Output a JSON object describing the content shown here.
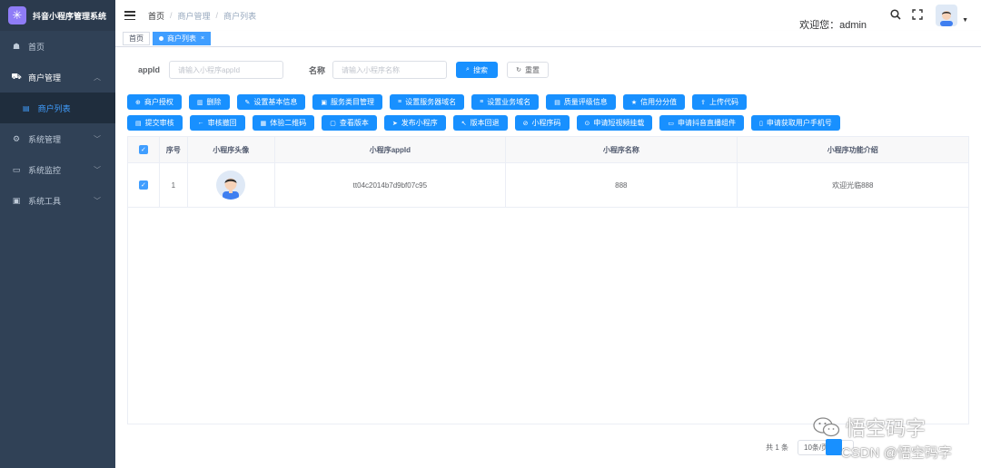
{
  "app": {
    "title": "抖音小程序管理系统",
    "logo_glyph": "✳"
  },
  "sidebar": {
    "items": [
      {
        "label": "首页",
        "icon": "dashboard-icon"
      },
      {
        "label": "商户管理",
        "icon": "shop-icon",
        "open": true
      },
      {
        "label": "商户列表",
        "icon": "list-icon",
        "sub": true,
        "active": true
      },
      {
        "label": "系统管理",
        "icon": "gear-icon"
      },
      {
        "label": "系统监控",
        "icon": "monitor-icon"
      },
      {
        "label": "系统工具",
        "icon": "tool-icon"
      }
    ]
  },
  "header": {
    "breadcrumb": [
      "首页",
      "商户管理",
      "商户列表"
    ],
    "welcome": "欢迎您：admin"
  },
  "tags": [
    {
      "label": "首页",
      "active": false
    },
    {
      "label": "商户列表",
      "active": true,
      "close": "×"
    }
  ],
  "search": {
    "appid_label": "appId",
    "appid_placeholder": "请输入小程序appId",
    "name_label": "名称",
    "name_placeholder": "请输入小程序名称",
    "search_btn": "搜索",
    "reset_btn": "重置"
  },
  "toolbar_row1": [
    {
      "label": "商户授权",
      "icon": "⊕"
    },
    {
      "label": "删除",
      "icon": "🗑"
    },
    {
      "label": "设置基本信息",
      "icon": "✎"
    },
    {
      "label": "服务类目管理",
      "icon": "▣"
    },
    {
      "label": "设置服务器域名",
      "icon": "≡"
    },
    {
      "label": "设置业务域名",
      "icon": "≡"
    },
    {
      "label": "质量评级信息",
      "icon": "▤"
    },
    {
      "label": "信用分分值",
      "icon": "★"
    },
    {
      "label": "上传代码",
      "icon": "⇪"
    }
  ],
  "toolbar_row2": [
    {
      "label": "提交审核",
      "icon": "▤"
    },
    {
      "label": "审核撤回",
      "icon": "←"
    },
    {
      "label": "体验二维码",
      "icon": "▦"
    },
    {
      "label": "查看版本",
      "icon": "▢"
    },
    {
      "label": "发布小程序",
      "icon": "➤"
    },
    {
      "label": "版本回退",
      "icon": "↖"
    },
    {
      "label": "小程序码",
      "icon": "⊘"
    },
    {
      "label": "申请短视频挂载",
      "icon": "⊙"
    },
    {
      "label": "申请抖音直播组件",
      "icon": "▭"
    },
    {
      "label": "申请获取用户手机号",
      "icon": "▯"
    }
  ],
  "table": {
    "columns": [
      "",
      "序号",
      "小程序头像",
      "小程序appId",
      "小程序名称",
      "小程序功能介绍"
    ],
    "rows": [
      {
        "index": "1",
        "appid": "tt04c2014b7d9bf07c95",
        "name": "888",
        "intro": "欢迎光临888"
      }
    ]
  },
  "pagination": {
    "total": "共 1 条",
    "page_size": "10条/页"
  },
  "watermark": {
    "line1": "悟空码字",
    "line2": "CSDN @悟空码字"
  }
}
